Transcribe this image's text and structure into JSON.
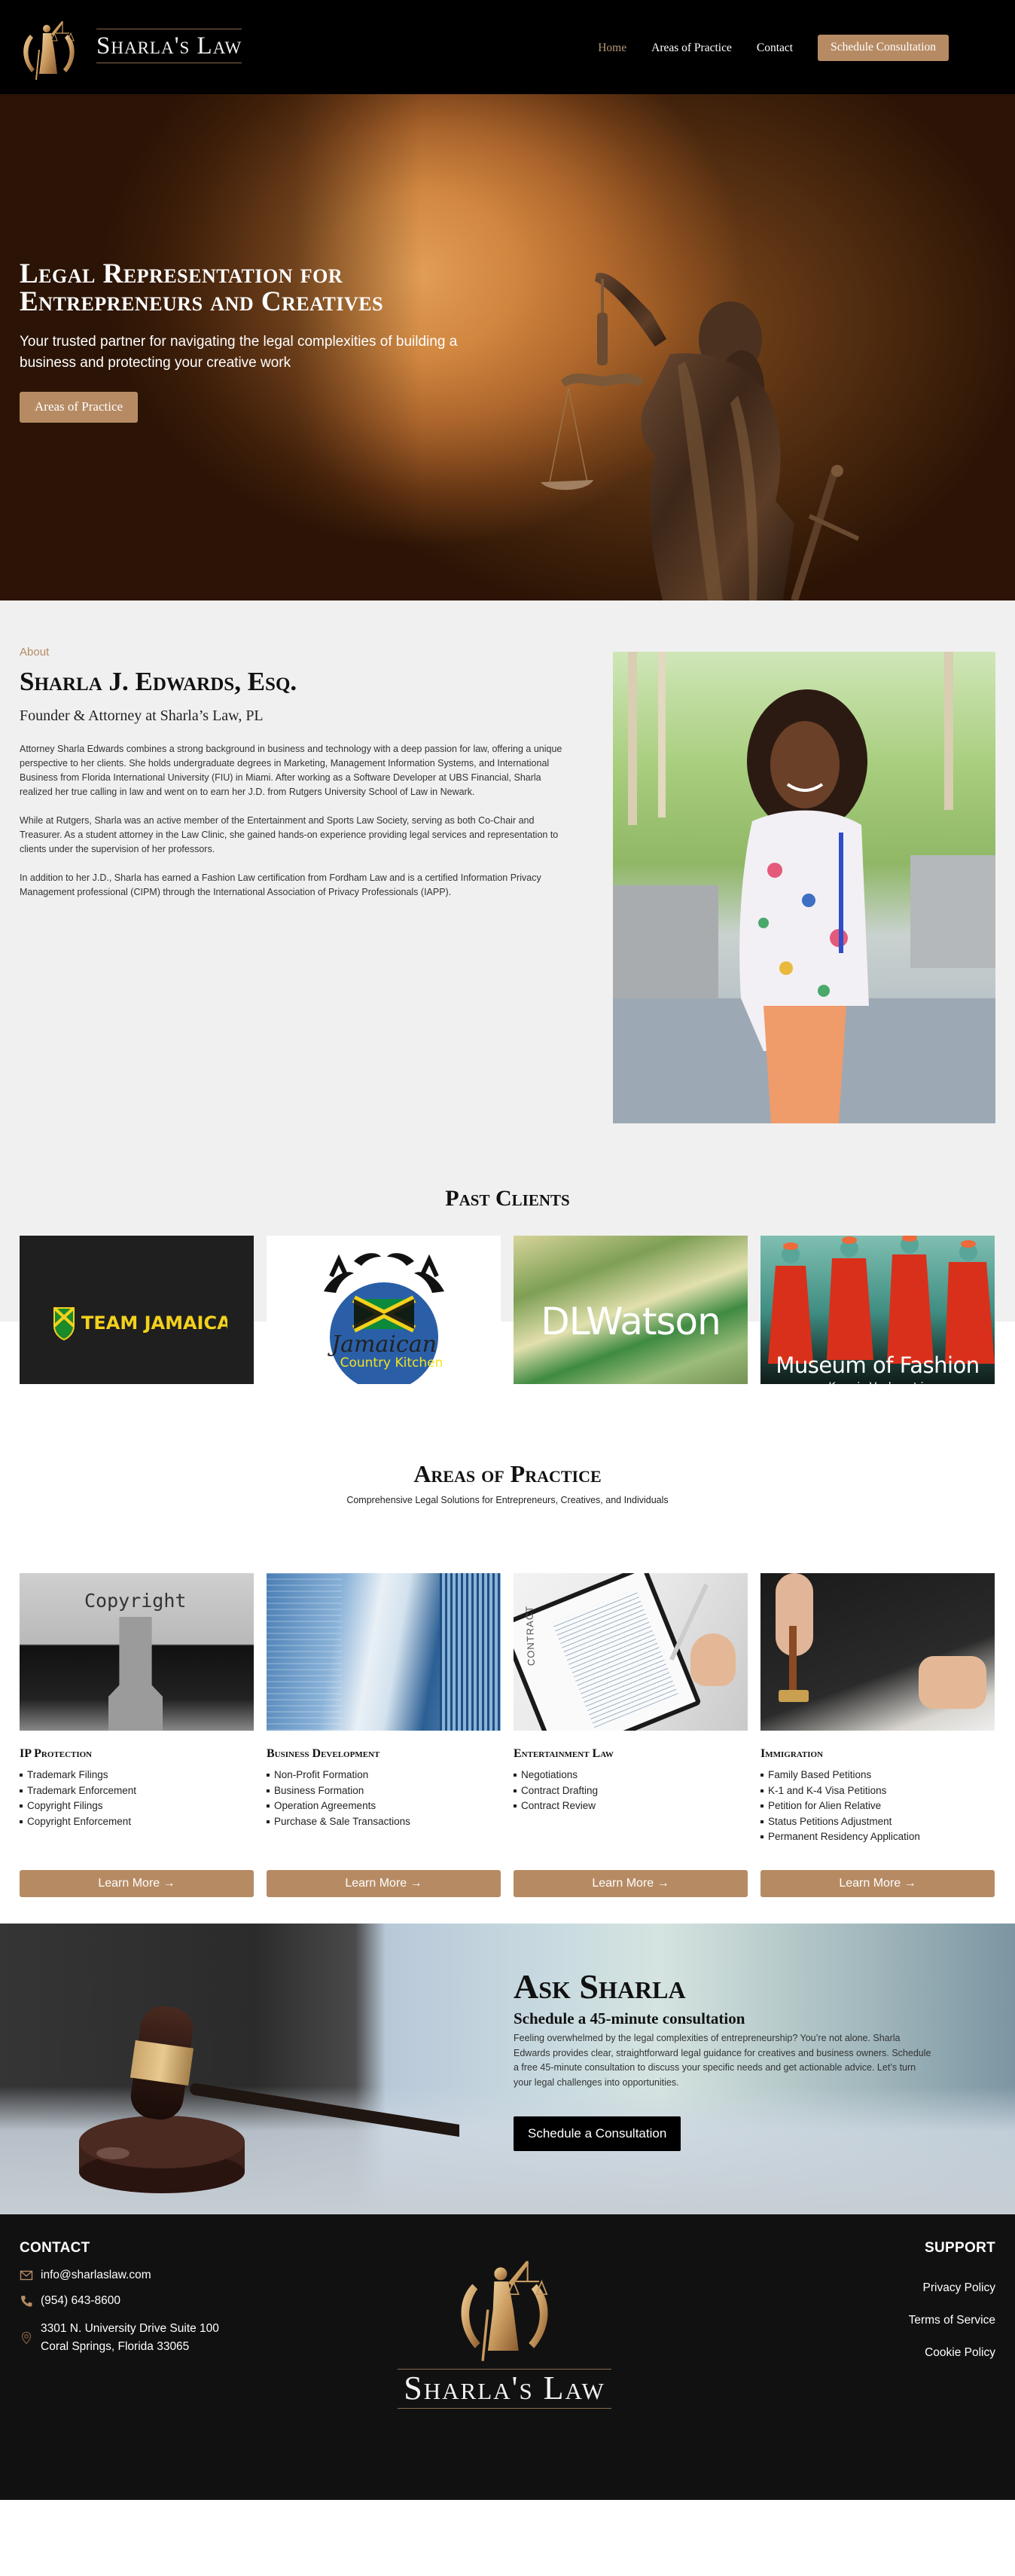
{
  "brand": {
    "name": "Sharla's Law",
    "accent_color": "#b68b64",
    "dark_color": "#000000",
    "footer_bg": "#111111"
  },
  "nav": {
    "items": [
      {
        "label": "Home",
        "active": true
      },
      {
        "label": "Areas of Practice",
        "active": false
      },
      {
        "label": "Contact",
        "active": false
      }
    ],
    "cta_label": "Schedule Consultation"
  },
  "hero": {
    "title": "Legal Representation for Entrepreneurs and Creatives",
    "subtitle": "Your trusted partner for navigating the legal complexities of building a business and protecting your creative work",
    "button_label": "Areas of Practice"
  },
  "about": {
    "eyebrow": "About",
    "name": "Sharla J. Edwards, Esq.",
    "role": "Founder & Attorney at Sharla’s Law, PL",
    "paragraphs": [
      "Attorney Sharla Edwards combines a strong background in business and technology with a deep passion for law, offering a unique perspective to her clients. She holds undergraduate degrees in Marketing, Management Information Systems, and International Business from Florida International University (FIU) in Miami. After working as a Software Developer at UBS Financial, Sharla realized her true calling in law and went on to earn her J.D. from Rutgers University School of Law in Newark.",
      "While at Rutgers, Sharla was an active member of the Entertainment and Sports Law Society, serving as both Co-Chair and Treasurer. As a student attorney in the Law Clinic, she gained hands-on experience providing legal services and representation to clients under the supervision of her professors.",
      "In addition to her J.D., Sharla has earned a Fashion Law certification from Fordham Law and is a certified Information Privacy Management professional (CIPM) through the International Association of Privacy Professionals (IAPP)."
    ],
    "photo_alt": "Portrait of Sharla J. Edwards"
  },
  "clients": {
    "title": "Past Clients",
    "items": [
      {
        "name": "Team Jamaica",
        "logo_text": "TEAM JAMAICA"
      },
      {
        "name": "Jamaican Country Kitchen",
        "logo_text_script": "Jamaican",
        "logo_text": "Country Kitchen"
      },
      {
        "name": "DLWatson",
        "logo_text": "DLWatson"
      },
      {
        "name": "Museum of Fashion",
        "logo_text": "Museum of Fashion",
        "logo_subtext": "Keni Valenti"
      }
    ]
  },
  "areas": {
    "title": "Areas of Practice",
    "subtitle": "Comprehensive Legal Solutions for Entrepreneurs, Creatives, and Individuals",
    "button_label": "Learn More →",
    "items": [
      {
        "title": "IP Protection",
        "image_text": "Copyright",
        "services": [
          "Trademark Filings",
          "Trademark Enforcement",
          "Copyright Filings",
          "Copyright Enforcement"
        ]
      },
      {
        "title": "Business Development",
        "image_text": "",
        "services": [
          "Non-Profit Formation",
          "Business Formation",
          "Operation Agreements",
          "Purchase & Sale Transactions"
        ]
      },
      {
        "title": "Entertainment Law",
        "image_text": "CONTRACT",
        "services": [
          "Negotiations",
          "Contract Drafting",
          "Contract Review"
        ]
      },
      {
        "title": "Immigration",
        "image_text": "",
        "services": [
          "Family Based Petitions",
          "K-1 and K-4 Visa Petitions",
          "Petition for Alien Relative",
          "Status Petitions Adjustment",
          "Permanent Residency Application"
        ]
      }
    ]
  },
  "ask": {
    "title": "Ask Sharla",
    "subtitle": "Schedule a 45-minute consultation",
    "body": "Feeling overwhelmed by the legal complexities of entrepreneurship? You’re not alone. Sharla Edwards provides clear, straightforward legal guidance for creatives and business owners. Schedule a free 45-minute consultation to discuss your specific needs and get actionable advice. Let’s turn your legal challenges into opportunities.",
    "button_label": "Schedule a Consultation"
  },
  "footer": {
    "contact_heading": "CONTACT",
    "email": "info@sharlaslaw.com",
    "phone": "(954) 643-8600",
    "address_line1": "3301 N. University Drive Suite 100",
    "address_line2": "Coral Springs, Florida 33065",
    "support_heading": "SUPPORT",
    "support_links": [
      "Privacy Policy",
      "Terms of Service",
      "Cookie Policy"
    ],
    "logo_text": "Sharla's Law"
  }
}
